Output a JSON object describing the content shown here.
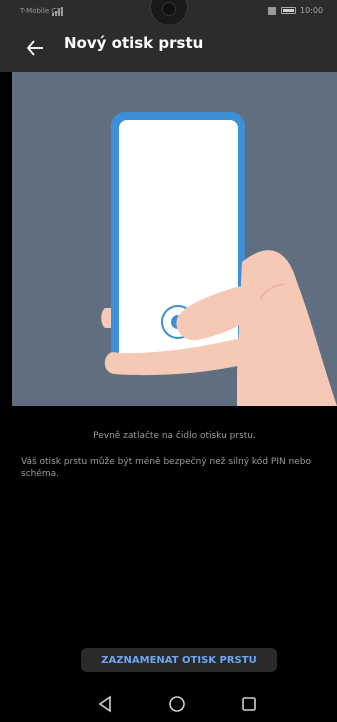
{
  "status_bar": {
    "carrier": "T-Mobile CZ",
    "time": "10:00",
    "icons": [
      "signal-icon",
      "sim-icon",
      "battery-icon"
    ]
  },
  "app_bar": {
    "title": "Nový otisk prstu",
    "back_icon": "arrow-left-icon"
  },
  "illustration": {
    "name": "hand-holding-phone-fingerprint",
    "colors": {
      "background": "#5f6f80",
      "phone_frame": "#3d8fd6",
      "screen": "#ffffff",
      "skin": "#f6c9b6",
      "sensor": "#3d8fd6"
    }
  },
  "instructions": {
    "main": "Pevně zatlačte na čidlo otisku prstu.",
    "note": "Váš otisk prstu může být méně bezpečný než silný kód PIN nebo schéma."
  },
  "record_button": {
    "label": "ZAZNAMENAT OTISK PRSTU",
    "color": "#6fa6f0"
  },
  "nav_bar": {
    "items": [
      "back-triangle-icon",
      "home-circle-icon",
      "recents-square-icon"
    ]
  }
}
